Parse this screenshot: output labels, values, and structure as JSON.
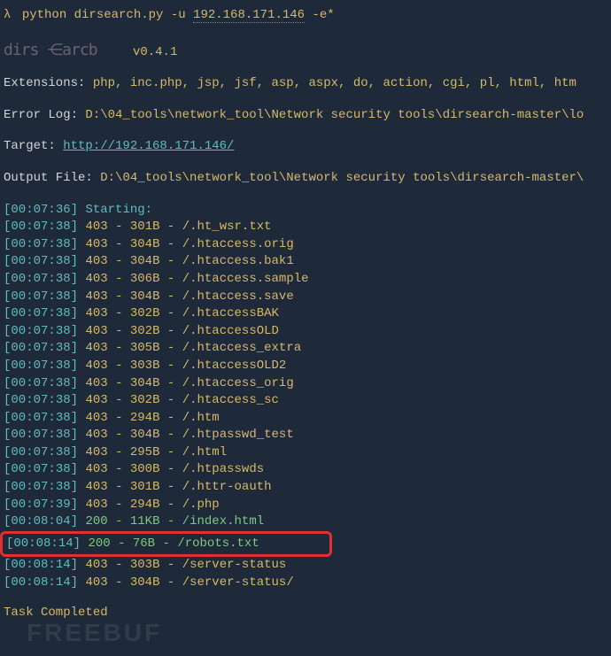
{
  "command": {
    "prompt": "λ",
    "cmd_prefix": "python dirsearch.py -u ",
    "url": "192.168.171.146",
    "cmd_suffix": " -e*"
  },
  "logo": {
    "ascii": "dirs ⋲arcb",
    "version": "v0.4.1"
  },
  "extensions": {
    "label": "Extensions:",
    "value": "php, inc.php, jsp, jsf, asp, aspx, do, action, cgi, pl, html, htm"
  },
  "errorlog": {
    "label": "Error Log:",
    "value": "D:\\04_tools\\network_tool\\Network security tools\\dirsearch-master\\lo"
  },
  "target": {
    "label": "Target:",
    "value": "http://192.168.171.146/"
  },
  "outputfile": {
    "label": "Output File:",
    "value": "D:\\04_tools\\network_tool\\Network security tools\\dirsearch-master\\"
  },
  "starting": {
    "ts": "00:07:36",
    "text": "Starting:"
  },
  "results": [
    {
      "ts": "00:07:38",
      "status": "403",
      "size": "301B",
      "path": "/.ht_wsr.txt"
    },
    {
      "ts": "00:07:38",
      "status": "403",
      "size": "304B",
      "path": "/.htaccess.orig"
    },
    {
      "ts": "00:07:38",
      "status": "403",
      "size": "304B",
      "path": "/.htaccess.bak1"
    },
    {
      "ts": "00:07:38",
      "status": "403",
      "size": "306B",
      "path": "/.htaccess.sample"
    },
    {
      "ts": "00:07:38",
      "status": "403",
      "size": "304B",
      "path": "/.htaccess.save"
    },
    {
      "ts": "00:07:38",
      "status": "403",
      "size": "302B",
      "path": "/.htaccessBAK"
    },
    {
      "ts": "00:07:38",
      "status": "403",
      "size": "302B",
      "path": "/.htaccessOLD"
    },
    {
      "ts": "00:07:38",
      "status": "403",
      "size": "305B",
      "path": "/.htaccess_extra"
    },
    {
      "ts": "00:07:38",
      "status": "403",
      "size": "303B",
      "path": "/.htaccessOLD2"
    },
    {
      "ts": "00:07:38",
      "status": "403",
      "size": "304B",
      "path": "/.htaccess_orig"
    },
    {
      "ts": "00:07:38",
      "status": "403",
      "size": "302B",
      "path": "/.htaccess_sc"
    },
    {
      "ts": "00:07:38",
      "status": "403",
      "size": "294B",
      "path": "/.htm"
    },
    {
      "ts": "00:07:38",
      "status": "403",
      "size": "304B",
      "path": "/.htpasswd_test"
    },
    {
      "ts": "00:07:38",
      "status": "403",
      "size": "295B",
      "path": "/.html"
    },
    {
      "ts": "00:07:38",
      "status": "403",
      "size": "300B",
      "path": "/.htpasswds"
    },
    {
      "ts": "00:07:38",
      "status": "403",
      "size": "301B",
      "path": "/.httr-oauth"
    },
    {
      "ts": "00:07:39",
      "status": "403",
      "size": "294B",
      "path": "/.php"
    },
    {
      "ts": "00:08:04",
      "status": "200",
      "size": "11KB",
      "path": "/index.html"
    },
    {
      "ts": "00:08:14",
      "status": "200",
      "size": "76B",
      "path": "/robots.txt",
      "hl": true
    },
    {
      "ts": "00:08:14",
      "status": "403",
      "size": "303B",
      "path": "/server-status"
    },
    {
      "ts": "00:08:14",
      "status": "403",
      "size": "304B",
      "path": "/server-status/"
    }
  ],
  "footer": "Task Completed",
  "watermark": "FREEBUF"
}
